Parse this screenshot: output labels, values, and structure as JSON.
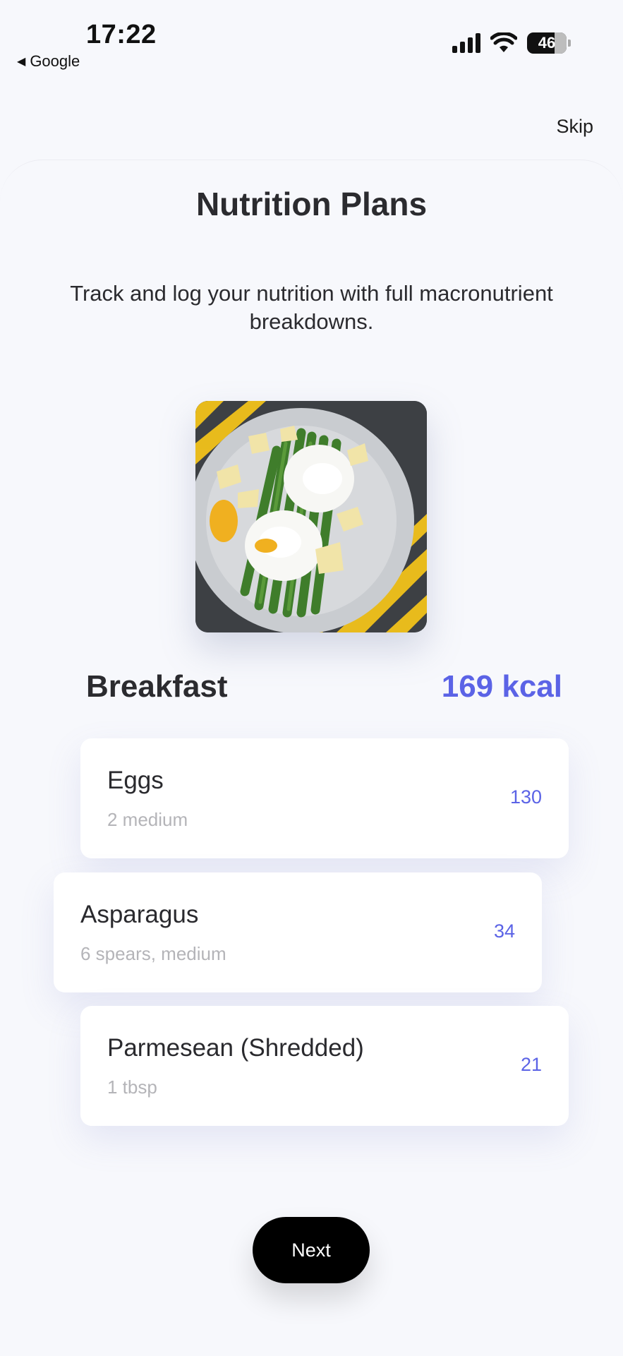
{
  "status_bar": {
    "time": "17:22",
    "back_app": "Google",
    "battery": "46"
  },
  "header": {
    "skip_label": "Skip"
  },
  "page": {
    "title": "Nutrition Plans",
    "subtitle": "Track and log your nutrition with full macronutrient breakdowns."
  },
  "meal": {
    "name": "Breakfast",
    "calories": "169 kcal",
    "items": [
      {
        "name": "Eggs",
        "quantity": "2 medium",
        "calories": "130"
      },
      {
        "name": "Asparagus",
        "quantity": "6 spears, medium",
        "calories": "34"
      },
      {
        "name": "Parmesean (Shredded)",
        "quantity": "1 tbsp",
        "calories": "21"
      }
    ]
  },
  "actions": {
    "next_label": "Next"
  },
  "colors": {
    "accent": "#5b63e6",
    "background": "#f7f8fc",
    "button": "#000000"
  }
}
